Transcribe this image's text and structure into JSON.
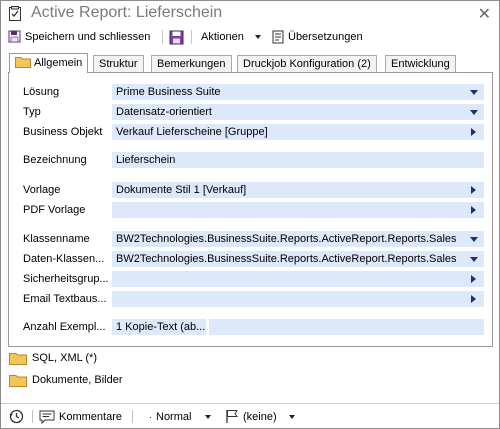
{
  "window": {
    "title": "Active Report: Lieferschein",
    "close_glyph": "✕"
  },
  "toolbar": {
    "save_close_label": "Speichern und schliessen",
    "actions_label": "Aktionen",
    "translations_label": "Übersetzungen"
  },
  "tabs": [
    {
      "label": "Allgemein",
      "active": true
    },
    {
      "label": "Struktur"
    },
    {
      "label": "Bemerkungen"
    },
    {
      "label": "Druckjob Konfiguration (2)"
    },
    {
      "label": "Entwicklung"
    }
  ],
  "form": {
    "loesung": {
      "label": "Lösung",
      "value": "Prime Business Suite",
      "control": "dropdown"
    },
    "typ": {
      "label": "Typ",
      "value": "Datensatz-orientiert",
      "control": "dropdown"
    },
    "business_objekt": {
      "label": "Business Objekt",
      "value": "Verkauf Lieferscheine [Gruppe]",
      "control": "lookup"
    },
    "bezeichnung": {
      "label": "Bezeichnung",
      "value": "Lieferschein"
    },
    "vorlage": {
      "label": "Vorlage",
      "value": "Dokumente Stil 1 [Verkauf]",
      "control": "lookup"
    },
    "pdf_vorlage": {
      "label": "PDF Vorlage",
      "value": "",
      "control": "lookup"
    },
    "klassenname": {
      "label": "Klassenname",
      "value": "BW2Technologies.BusinessSuite.Reports.ActiveReport.Reports.Sales.",
      "control": "dropdown"
    },
    "daten_klassen": {
      "label": "Daten-Klassen...",
      "value": "BW2Technologies.BusinessSuite.Reports.ActiveReport.Reports.Sales.",
      "control": "dropdown"
    },
    "sicherheitsgruppe": {
      "label": "Sicherheitsgrup...",
      "value": "",
      "control": "lookup"
    },
    "email_textbaustein": {
      "label": "Email Textbaus...",
      "value": "",
      "control": "lookup"
    },
    "anzahl_exemplare": {
      "label": "Anzahl Exempl...",
      "value": "1 Kopie-Text  (ab..."
    }
  },
  "sections": [
    {
      "label": "SQL, XML (*)"
    },
    {
      "label": "Dokumente, Bilder"
    }
  ],
  "statusbar": {
    "comments_label": "Kommentare",
    "priority_label": "Normal",
    "flag_label": "(keine)"
  },
  "colors": {
    "field_bg": "#dde8fb",
    "arrow": "#1c2f7a",
    "folder": "#e8b84a"
  }
}
